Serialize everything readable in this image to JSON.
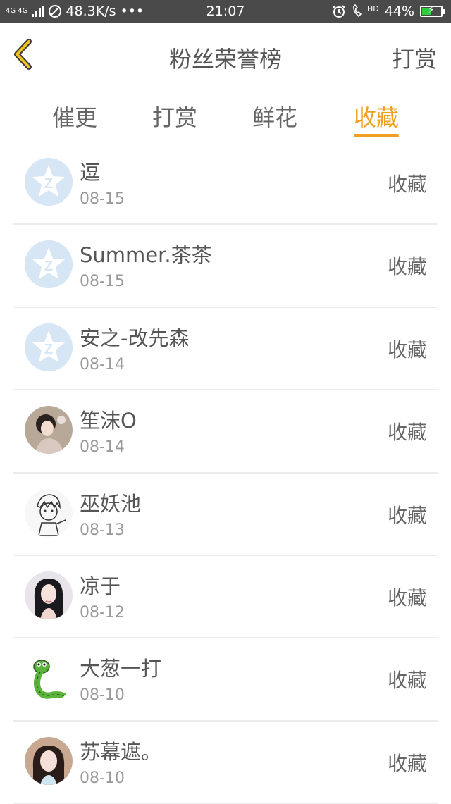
{
  "status_bar": {
    "network": "4G 4G",
    "speed": "48.3K/s",
    "dots": "•••",
    "time": "21:07",
    "hd": "HD",
    "battery": "44%"
  },
  "header": {
    "title": "粉丝荣誉榜",
    "right_action": "打赏"
  },
  "tabs": [
    {
      "label": "催更"
    },
    {
      "label": "打赏"
    },
    {
      "label": "鲜花"
    },
    {
      "label": "收藏"
    }
  ],
  "active_tab": "收藏",
  "colors": {
    "accent": "#f0a020",
    "status_bar": "#4a4a4a",
    "default_avatar": "#dbe8f5"
  },
  "list": [
    {
      "name": "逗",
      "date": "08-15",
      "action": "收藏",
      "avatar": "default-qq-avatar"
    },
    {
      "name": "Summer.茶茶",
      "date": "08-15",
      "action": "收藏",
      "avatar": "default-qq-avatar"
    },
    {
      "name": "安之-改先森",
      "date": "08-14",
      "action": "收藏",
      "avatar": "default-qq-avatar"
    },
    {
      "name": "笙沫O",
      "date": "08-14",
      "action": "收藏",
      "avatar": "girl-photo-avatar"
    },
    {
      "name": "巫妖池",
      "date": "08-13",
      "action": "收藏",
      "avatar": "sketch-boy-avatar"
    },
    {
      "name": "凉于",
      "date": "08-12",
      "action": "收藏",
      "avatar": "girl-photo-avatar"
    },
    {
      "name": "大葱一打",
      "date": "08-10",
      "action": "收藏",
      "avatar": "green-snake-avatar"
    },
    {
      "name": "苏幕遮。",
      "date": "08-10",
      "action": "收藏",
      "avatar": "girl-photo-avatar"
    }
  ]
}
